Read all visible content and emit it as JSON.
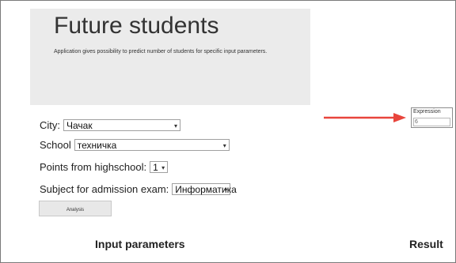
{
  "hero": {
    "title": "Future students",
    "subtitle": "Application gives possibility to predict number of students for specific input parameters."
  },
  "form": {
    "city_label": "City:",
    "city_value": "Чачак",
    "school_label": "School",
    "school_value": "техничка",
    "points_label": "Points from highschool:",
    "points_value": "1",
    "subject_label": "Subject for admission exam:",
    "subject_value": "Информатика",
    "analysis_button": "Analysis"
  },
  "footer": {
    "input_parameters": "Input parameters",
    "result": "Result"
  },
  "expression": {
    "label": "Expression",
    "value": "6"
  },
  "colors": {
    "arrow": "#e8453c",
    "hero_bg": "#ebebeb"
  },
  "icons": {
    "select_caret": "dropdown-caret",
    "annotation_arrow": "arrow-right-icon"
  }
}
